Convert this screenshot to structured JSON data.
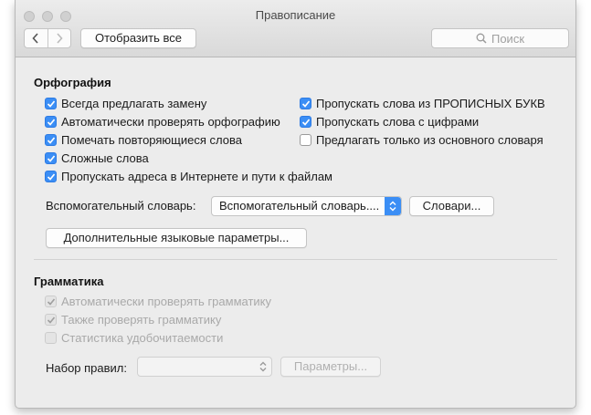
{
  "window": {
    "title": "Правописание"
  },
  "toolbar": {
    "show_all_label": "Отобразить все",
    "search_placeholder": "Поиск"
  },
  "spelling": {
    "title": "Орфография",
    "left_options": [
      {
        "label": "Всегда предлагать замену",
        "checked": true
      },
      {
        "label": "Автоматически проверять орфографию",
        "checked": true
      },
      {
        "label": "Помечать повторяющиеся слова",
        "checked": true
      },
      {
        "label": "Сложные слова",
        "checked": true
      },
      {
        "label": "Пропускать адреса в Интернете и пути к файлам",
        "checked": true
      }
    ],
    "right_options": [
      {
        "label": "Пропускать слова из ПРОПИСНЫХ БУКВ",
        "checked": true
      },
      {
        "label": "Пропускать слова с цифрами",
        "checked": true
      },
      {
        "label": "Предлагать только из основного словаря",
        "checked": false
      }
    ],
    "custom_dictionary_label": "Вспомогательный словарь:",
    "custom_dictionary_value": "Вспомогательный словарь....",
    "dictionaries_button": "Словари...",
    "advanced_button": "Дополнительные языковые параметры..."
  },
  "grammar": {
    "title": "Грамматика",
    "options": [
      {
        "label": "Автоматически проверять грамматику",
        "checked": true,
        "enabled": false
      },
      {
        "label": "Также проверять грамматику",
        "checked": true,
        "enabled": false
      },
      {
        "label": "Статистика удобочитаемости",
        "checked": false,
        "enabled": false
      }
    ],
    "ruleset_label": "Набор правил:",
    "ruleset_value": "",
    "settings_button": "Параметры..."
  },
  "colors": {
    "accent": "#3b8ef5",
    "window_bg": "#ececec",
    "disabled_text": "#a9a9a9"
  }
}
